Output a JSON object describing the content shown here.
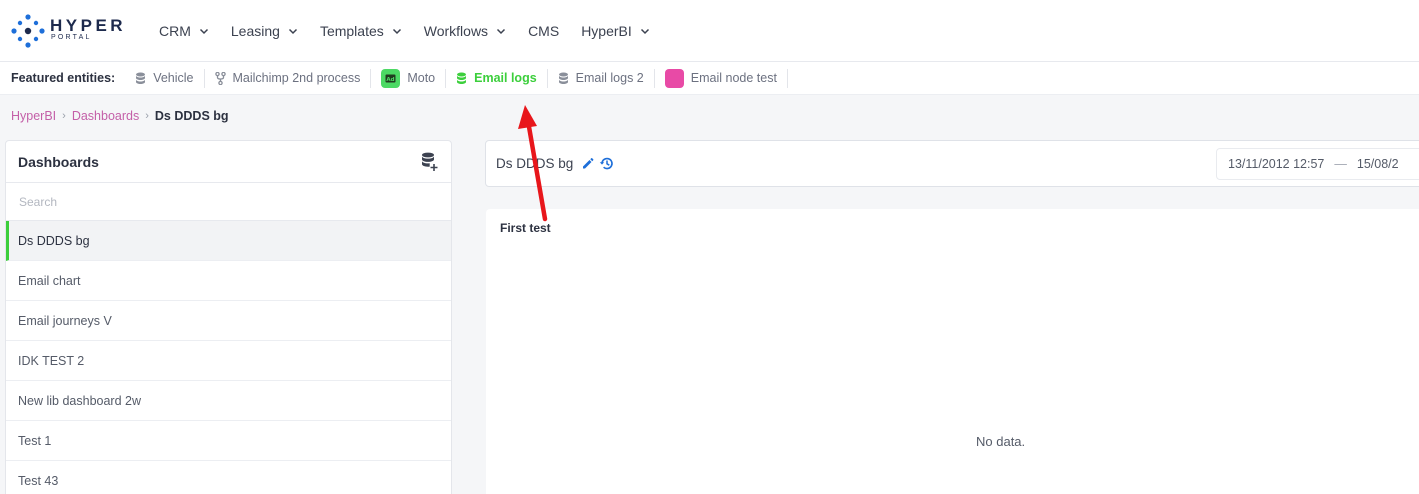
{
  "brand": {
    "name": "HYPER",
    "sub": "PORTAL"
  },
  "nav": {
    "items": [
      {
        "label": "CRM",
        "dropdown": true
      },
      {
        "label": "Leasing",
        "dropdown": true
      },
      {
        "label": "Templates",
        "dropdown": true
      },
      {
        "label": "Workflows",
        "dropdown": true
      },
      {
        "label": "CMS",
        "dropdown": false
      },
      {
        "label": "HyperBI",
        "dropdown": true
      }
    ]
  },
  "featured": {
    "label": "Featured entities:",
    "items": [
      {
        "label": "Vehicle",
        "icon": "database-icon",
        "active": false
      },
      {
        "label": "Mailchimp 2nd process",
        "icon": "fork-icon",
        "active": false
      },
      {
        "label": "Moto",
        "icon": "ad-square-icon",
        "color": "#4cd964",
        "active": false
      },
      {
        "label": "Email logs",
        "icon": "database-icon",
        "active": true
      },
      {
        "label": "Email logs 2",
        "icon": "database-icon",
        "active": false
      },
      {
        "label": "Email node test",
        "icon": "pink-square-icon",
        "color": "#e84aa6",
        "active": false
      }
    ]
  },
  "breadcrumb": {
    "items": [
      "HyperBI",
      "Dashboards"
    ],
    "current": "Ds DDDS bg"
  },
  "sidebar": {
    "title": "Dashboards",
    "search_placeholder": "Search",
    "items": [
      {
        "label": "Ds DDDS bg",
        "active": true
      },
      {
        "label": "Email chart",
        "active": false
      },
      {
        "label": "Email journeys V",
        "active": false
      },
      {
        "label": "IDK TEST 2",
        "active": false
      },
      {
        "label": "New lib dashboard 2w",
        "active": false
      },
      {
        "label": "Test 1",
        "active": false
      },
      {
        "label": "Test 43",
        "active": false
      }
    ]
  },
  "dashboard": {
    "name": "Ds DDDS bg",
    "date_from": "13/11/2012 12:57",
    "date_sep": "—",
    "date_to": "15/08/2"
  },
  "widget": {
    "title": "First test",
    "empty_text": "No data."
  },
  "colors": {
    "accent_green": "#3ccf3c",
    "breadcrumb_link": "#c45fa8",
    "icon_blue": "#1e6fd9",
    "annotation_arrow": "#e8161b"
  }
}
